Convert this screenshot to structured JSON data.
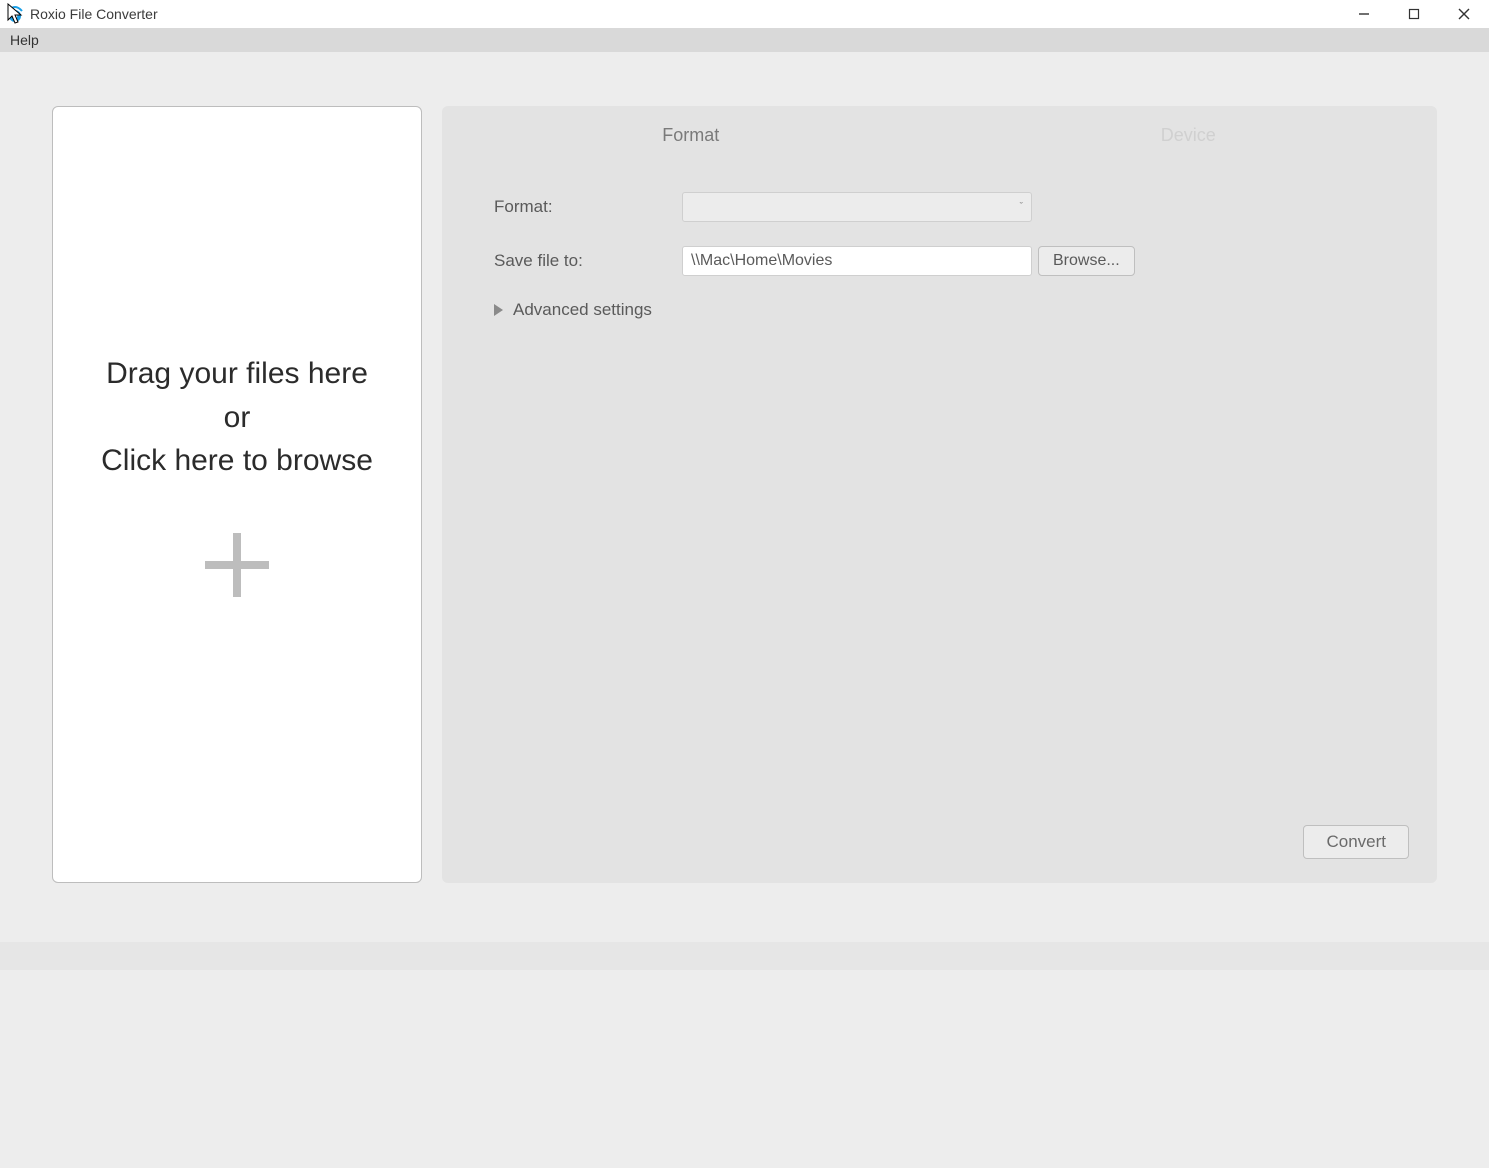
{
  "window": {
    "title": "Roxio File Converter"
  },
  "menubar": {
    "help": "Help"
  },
  "drop": {
    "line1": "Drag your files here",
    "line2": "or",
    "line3": "Click here to browse"
  },
  "tabs": {
    "format": "Format",
    "device": "Device"
  },
  "form": {
    "format_label": "Format:",
    "format_value": "",
    "save_label": "Save file to:",
    "save_value": "\\\\Mac\\Home\\Movies",
    "browse_label": "Browse...",
    "advanced_label": "Advanced settings"
  },
  "actions": {
    "convert": "Convert"
  }
}
